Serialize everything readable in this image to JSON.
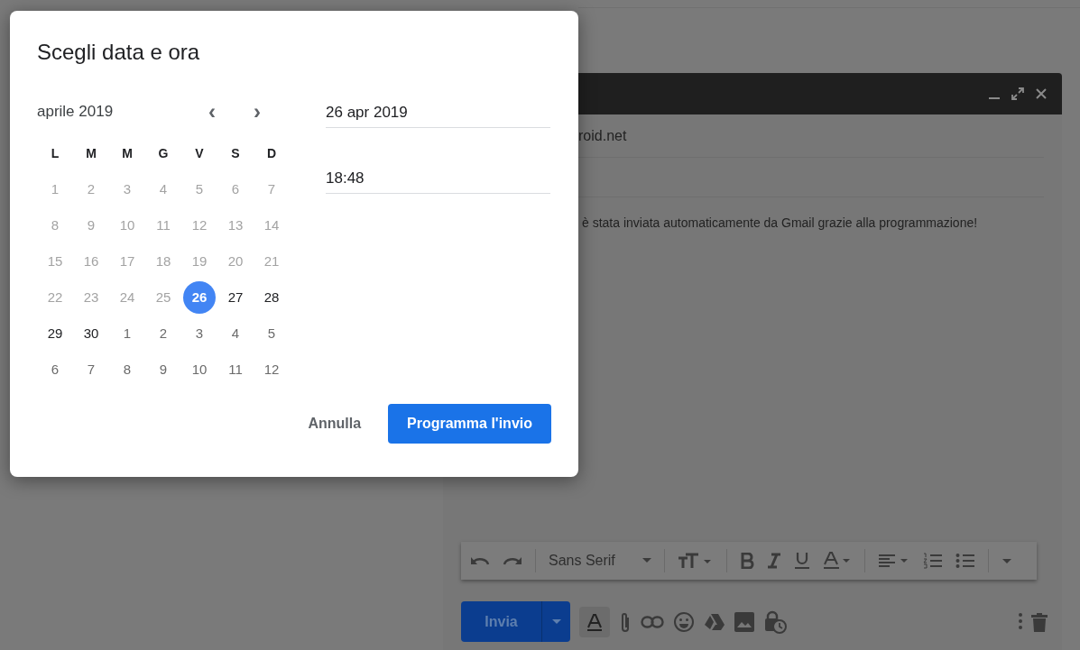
{
  "dialog": {
    "title": "Scegli data e ora",
    "month": "aprile 2019",
    "prev_icon": "‹",
    "next_icon": "›",
    "weekdays": [
      "L",
      "M",
      "M",
      "G",
      "V",
      "S",
      "D"
    ],
    "weeks": [
      [
        {
          "label": "1",
          "kind": "past",
          "selected": false
        },
        {
          "label": "2",
          "kind": "past",
          "selected": false
        },
        {
          "label": "3",
          "kind": "past",
          "selected": false
        },
        {
          "label": "4",
          "kind": "past",
          "selected": false
        },
        {
          "label": "5",
          "kind": "past",
          "selected": false
        },
        {
          "label": "6",
          "kind": "past",
          "selected": false
        },
        {
          "label": "7",
          "kind": "past",
          "selected": false
        }
      ],
      [
        {
          "label": "8",
          "kind": "past",
          "selected": false
        },
        {
          "label": "9",
          "kind": "past",
          "selected": false
        },
        {
          "label": "10",
          "kind": "past",
          "selected": false
        },
        {
          "label": "11",
          "kind": "past",
          "selected": false
        },
        {
          "label": "12",
          "kind": "past",
          "selected": false
        },
        {
          "label": "13",
          "kind": "past",
          "selected": false
        },
        {
          "label": "14",
          "kind": "past",
          "selected": false
        }
      ],
      [
        {
          "label": "15",
          "kind": "past",
          "selected": false
        },
        {
          "label": "16",
          "kind": "past",
          "selected": false
        },
        {
          "label": "17",
          "kind": "past",
          "selected": false
        },
        {
          "label": "18",
          "kind": "past",
          "selected": false
        },
        {
          "label": "19",
          "kind": "past",
          "selected": false
        },
        {
          "label": "20",
          "kind": "past",
          "selected": false
        },
        {
          "label": "21",
          "kind": "past",
          "selected": false
        }
      ],
      [
        {
          "label": "22",
          "kind": "past",
          "selected": false
        },
        {
          "label": "23",
          "kind": "past",
          "selected": false
        },
        {
          "label": "24",
          "kind": "past",
          "selected": false
        },
        {
          "label": "25",
          "kind": "past",
          "selected": false
        },
        {
          "label": "26",
          "kind": "current",
          "selected": true
        },
        {
          "label": "27",
          "kind": "current",
          "selected": false
        },
        {
          "label": "28",
          "kind": "current",
          "selected": false
        }
      ],
      [
        {
          "label": "29",
          "kind": "current",
          "selected": false
        },
        {
          "label": "30",
          "kind": "current",
          "selected": false
        },
        {
          "label": "1",
          "kind": "next",
          "selected": false
        },
        {
          "label": "2",
          "kind": "next",
          "selected": false
        },
        {
          "label": "3",
          "kind": "next",
          "selected": false
        },
        {
          "label": "4",
          "kind": "next",
          "selected": false
        },
        {
          "label": "5",
          "kind": "next",
          "selected": false
        }
      ],
      [
        {
          "label": "6",
          "kind": "next",
          "selected": false
        },
        {
          "label": "7",
          "kind": "next",
          "selected": false
        },
        {
          "label": "8",
          "kind": "next",
          "selected": false
        },
        {
          "label": "9",
          "kind": "next",
          "selected": false
        },
        {
          "label": "10",
          "kind": "next",
          "selected": false
        },
        {
          "label": "11",
          "kind": "next",
          "selected": false
        },
        {
          "label": "12",
          "kind": "next",
          "selected": false
        }
      ]
    ],
    "date_field": {
      "value": "26 apr 2019"
    },
    "time_field": {
      "value": "18:48"
    },
    "buttons": [
      {
        "label": "Annulla",
        "kind": "text"
      },
      {
        "label": "Programma l'invio",
        "kind": "primary"
      }
    ]
  },
  "compose": {
    "recipient": "roid.net",
    "body": "è stata inviata automaticamente da Gmail grazie alla programmazione!",
    "font": "Sans Serif",
    "send_button": "Invia"
  }
}
